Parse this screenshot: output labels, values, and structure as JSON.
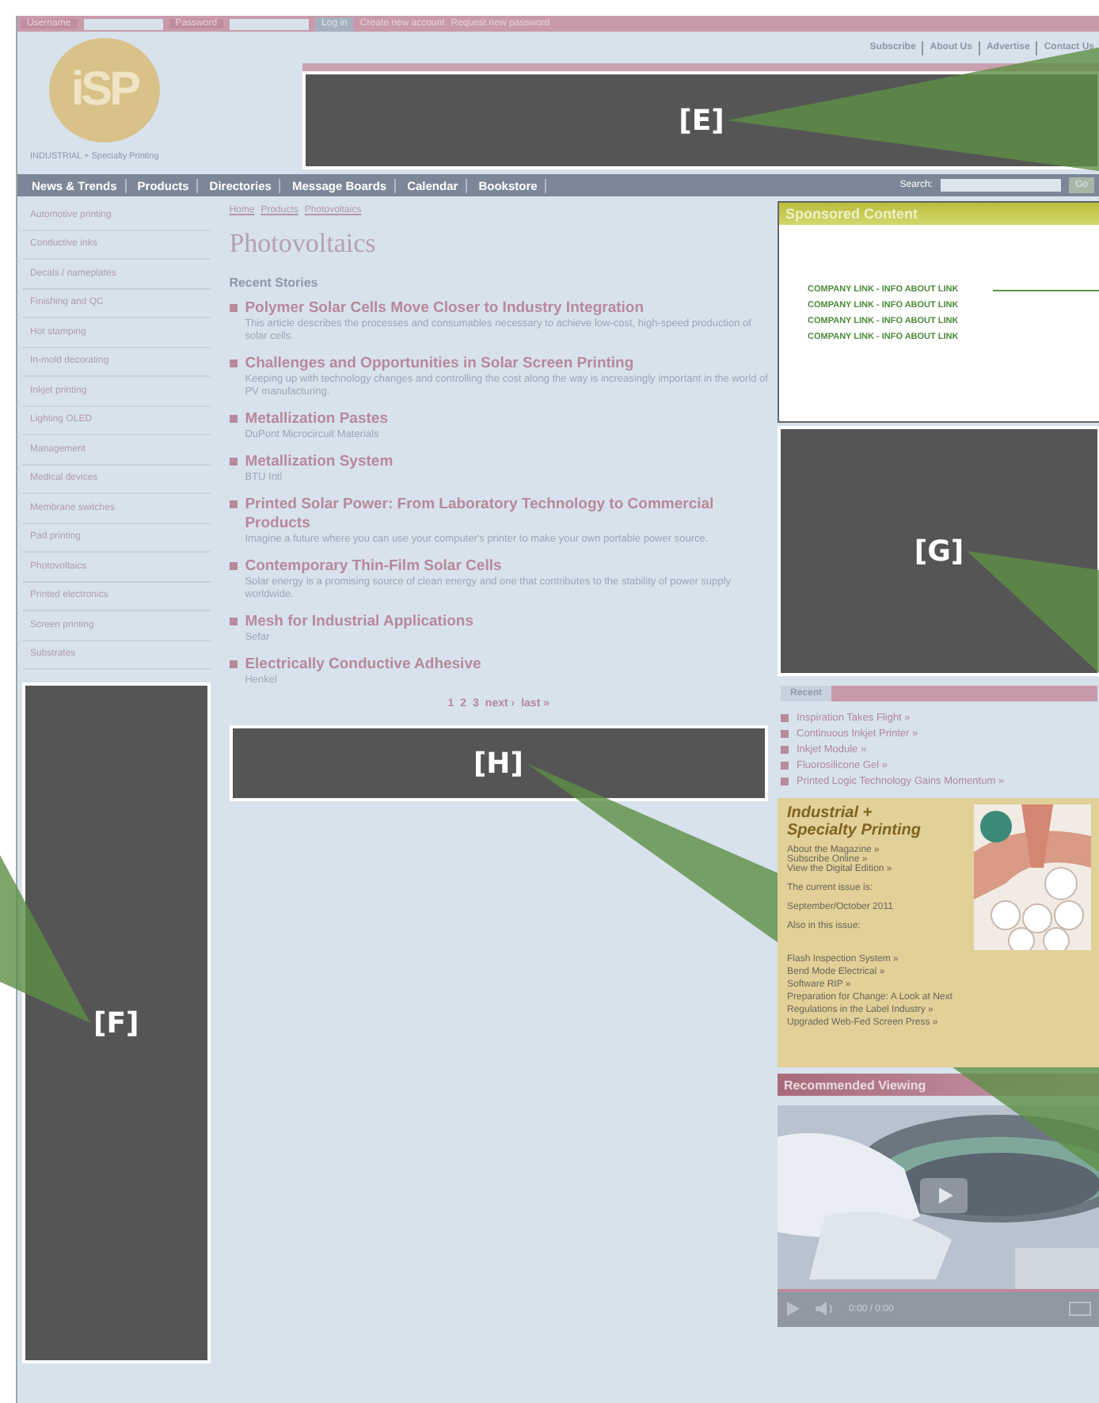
{
  "top_bar": {
    "username_label": "Username",
    "password_label": "Password",
    "login_button": "Log in",
    "links": [
      "Create new account",
      "Request new password"
    ]
  },
  "header": {
    "logo": "iSP",
    "tagline": "INDUSTRIAL + Specialty Printing",
    "links": [
      "Subscribe",
      "About Us",
      "Advertise",
      "Contact Us"
    ],
    "banner_annotation": "[E]"
  },
  "nav": {
    "items": [
      "News & Trends",
      "Products",
      "Directories",
      "Message Boards",
      "Calendar",
      "Bookstore"
    ],
    "search_label": "Search:",
    "search_button": "Go"
  },
  "sidebar": {
    "items": [
      "Automotive printing",
      "Conductive inks",
      "Decals / nameplates",
      "Finishing and QC",
      "Hot stamping",
      "In-mold decorating",
      "Inkjet printing",
      "Lighting OLED",
      "Management",
      "Medical devices",
      "Membrane switches",
      "Pad printing",
      "Photovoltaics",
      "Printed electronics",
      "Screen printing",
      "Substrates"
    ],
    "annotation": "[F]"
  },
  "main": {
    "breadcrumb": [
      "Home",
      "Products",
      "Photovoltaics"
    ],
    "title": "Photovoltaics",
    "section_title": "Recent Stories",
    "stories": [
      {
        "title": "Polymer Solar Cells Move Closer to Industry Integration",
        "summary": "This article describes the processes and consumables necessary to achieve low-cost, high-speed production of solar cells."
      },
      {
        "title": "Challenges and Opportunities in Solar Screen Printing",
        "summary": "Keeping up with technology changes and controlling the cost along the way is increasingly important in the world of PV manufacturing."
      },
      {
        "title": "Metallization Pastes",
        "summary": "DuPont Microcircuit Materials"
      },
      {
        "title": "Metallization System",
        "summary": "BTU Intl"
      },
      {
        "title": "Printed Solar Power: From Laboratory Technology to Commercial Products",
        "summary": "Imagine a future where you can use your computer's printer to make your own portable power source."
      },
      {
        "title": "Contemporary Thin-Film Solar Cells",
        "summary": "Solar energy is a promising source of clean energy and one that contributes to the stability of power supply worldwide."
      },
      {
        "title": "Mesh for Industrial Applications",
        "summary": "Sefar"
      },
      {
        "title": "Electrically Conductive Adhesive",
        "summary": "Henkel"
      }
    ],
    "pager": [
      "1",
      "2",
      "3",
      "next ›",
      "last »"
    ],
    "annotation": "[H]"
  },
  "right": {
    "sponsored": {
      "title": "Sponsored Content",
      "links": [
        "COMPANY LINK - INFO ABOUT LINK",
        "COMPANY LINK - INFO ABOUT LINK",
        "COMPANY LINK - INFO ABOUT LINK",
        "COMPANY LINK - INFO ABOUT LINK"
      ]
    },
    "annotation": "[G]",
    "recent": {
      "title": "Recent",
      "items": [
        "Inspiration Takes Flight »",
        "Continuous Inkjet Printer »",
        "Inkjet Module »",
        "Fluorosilicone Gel »",
        "Printed Logic Technology Gains Momentum »"
      ]
    },
    "magazine": {
      "title": "Industrial + Specialty Printing",
      "links": [
        "About the Magazine »",
        "Subscribe Online »",
        "View the Digital Edition »"
      ],
      "current_label": "The current issue is:",
      "current_issue": "September/October 2011",
      "also_label": "Also in this issue:",
      "articles": [
        "Flash Inspection System »",
        "Bend Mode Electrical »",
        "Software RIP »",
        "Preparation for Change: A Look at Next",
        "Regulations in the Label Industry »",
        "Upgraded Web-Fed Screen Press »"
      ]
    },
    "video": {
      "title": "Recommended Viewing",
      "time": "0:00 / 0:00"
    }
  }
}
